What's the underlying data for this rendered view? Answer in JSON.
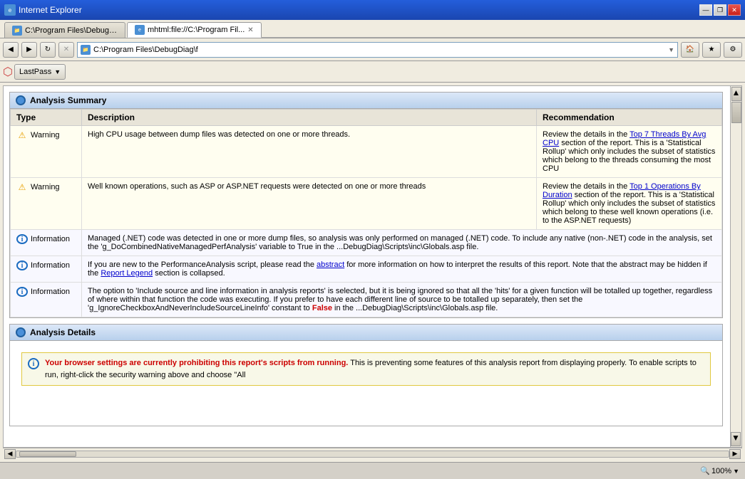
{
  "window": {
    "title": "Internet Explorer",
    "controls": {
      "minimize": "—",
      "restore": "❐",
      "close": "✕"
    }
  },
  "tabs": [
    {
      "id": "tab1",
      "label": "C:\\Program Files\\DebugDiag\\f",
      "active": false
    },
    {
      "id": "tab2",
      "label": "mhtml:file://C:\\Program Fil...",
      "active": true
    }
  ],
  "address": {
    "url": "C:\\Program Files\\DebugDiag\\f",
    "nav_back": "◀",
    "nav_forward": "▶",
    "refresh": "↻",
    "stop": "✕"
  },
  "toolbar": {
    "lastpass_label": "LastPass",
    "home_icon": "🏠",
    "favorites_icon": "★",
    "settings_icon": "⚙"
  },
  "analysis_summary": {
    "title": "Analysis Summary",
    "columns": {
      "type": "Type",
      "description": "Description",
      "recommendation": "Recommendation"
    },
    "rows": [
      {
        "type_icon": "warning",
        "type_label": "Warning",
        "description": "High CPU usage between dump files was detected on one or more threads.",
        "recommendation_prefix": "Review the details in the ",
        "recommendation_link": "Top 7 Threads By Avg CPU",
        "recommendation_link_href": "#top7threads",
        "recommendation_suffix": " section of the report. This is a 'Statistical Rollup' which only includes the subset of statistics which belong to the threads consuming the most CPU"
      },
      {
        "type_icon": "warning",
        "type_label": "Warning",
        "description": "Well known operations, such as ASP or ASP.NET requests were detected on one or more threads",
        "recommendation_prefix": "Review the details in the ",
        "recommendation_link": "Top 1 Operations By Duration",
        "recommendation_link_href": "#top1ops",
        "recommendation_suffix": " section of the report. This is a 'Statistical Rollup' which only includes the subset of statistics which belong to these well known operations (i.e. to the ASP.NET requests)"
      },
      {
        "type_icon": "info",
        "type_label": "Information",
        "description": "Managed (.NET) code was detected in one or more dump files, so analysis was only performed on managed (.NET) code. To include any native (non-.NET) code in the analysis, set the 'g_DoCombinedNativeManagedPerfAnalysis' variable to True in the ...DebugDiag\\Scripts\\inc\\Globals.asp file.",
        "recommendation": ""
      },
      {
        "type_icon": "info",
        "type_label": "Information",
        "description_prefix": "If you are new to the PerformanceAnalysis script, please read the ",
        "description_link": "abstract",
        "description_link_href": "#abstract",
        "description_middle": " for more information on how to interpret the results of this report.   Note that the abstract may be hidden if the ",
        "description_link2": "Report Legend",
        "description_link2_href": "#reportlegend",
        "description_suffix": " section is collapsed.",
        "recommendation": ""
      },
      {
        "type_icon": "info",
        "type_label": "Information",
        "description_prefix": "The option to 'Include source and line information in analysis reports' is selected, but it is being ignored so that all the 'hits' for a given function will be totalled up together, regardless of where within that function the code was executing. If you prefer to have each different line of source to be totalled up separately, then set the 'g_IgnoreCheckboxAndNeverIncludeSourceLineInfo' constant to ",
        "description_red": "False",
        "description_suffix": " in the ...DebugDiag\\Scripts\\inc\\Globals.asp file.",
        "recommendation": ""
      }
    ]
  },
  "analysis_details": {
    "title": "Analysis Details",
    "info_message_bold": "Your browser settings are currently prohibiting this report's scripts from running.",
    "info_message_normal": " This is preventing some features of this analysis report from displaying properly. To enable scripts to run, right-click the security warning above and choose \"All"
  },
  "status_bar": {
    "zoom_label": "100%",
    "zoom_icon": "🔍"
  }
}
